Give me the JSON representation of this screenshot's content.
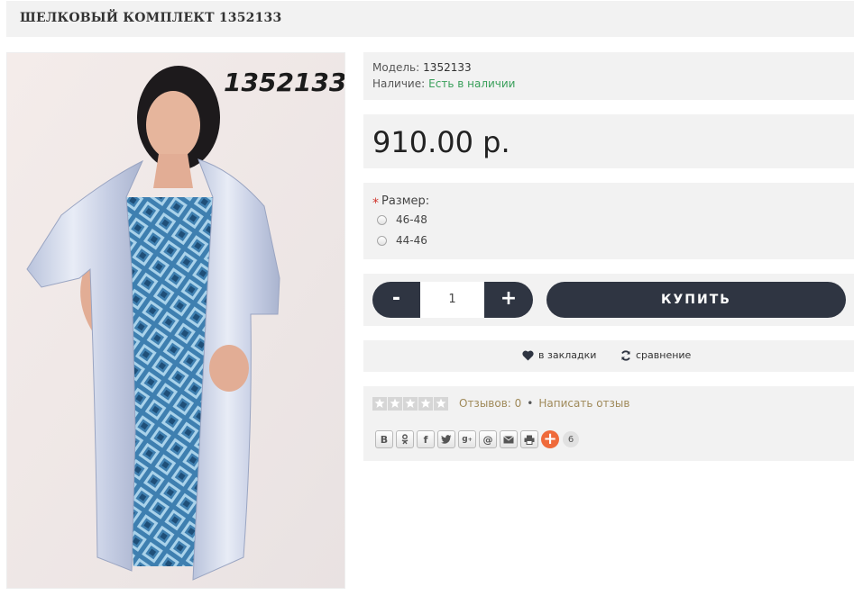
{
  "product": {
    "title": "ШЕЛКОВЫЙ КОМПЛЕКТ 1352133",
    "photo_overlay_code": "1352133"
  },
  "info": {
    "model_label": "Модель:",
    "model_value": "1352133",
    "availability_label": "Наличие:",
    "availability_value": "Есть в наличии"
  },
  "price": "910.00 р.",
  "options": {
    "required_mark": "*",
    "size_label": "Размер:",
    "sizes": [
      "46-48",
      "44-46"
    ]
  },
  "cart": {
    "minus_label": "-",
    "quantity": "1",
    "plus_label": "+",
    "buy_label": "КУПИТЬ"
  },
  "actions": {
    "wishlist_label": "в закладки",
    "compare_label": "сравнение"
  },
  "reviews": {
    "rating": 0,
    "rating_max": 5,
    "count_label": "Отзывов: 0",
    "separator": "•",
    "write_label": "Написать отзыв"
  },
  "share": {
    "buttons": [
      "vk-icon",
      "odnoklassniki-icon",
      "facebook-icon",
      "twitter-icon",
      "google-plus-icon",
      "email-at-icon",
      "mail-envelope-icon",
      "print-icon"
    ],
    "count": "6"
  },
  "colors": {
    "accent_dark": "#2f3542",
    "in_stock": "#3aa05b",
    "link": "#a08a5a",
    "required": "#d0342c",
    "share_plus": "#ef6a3a"
  }
}
